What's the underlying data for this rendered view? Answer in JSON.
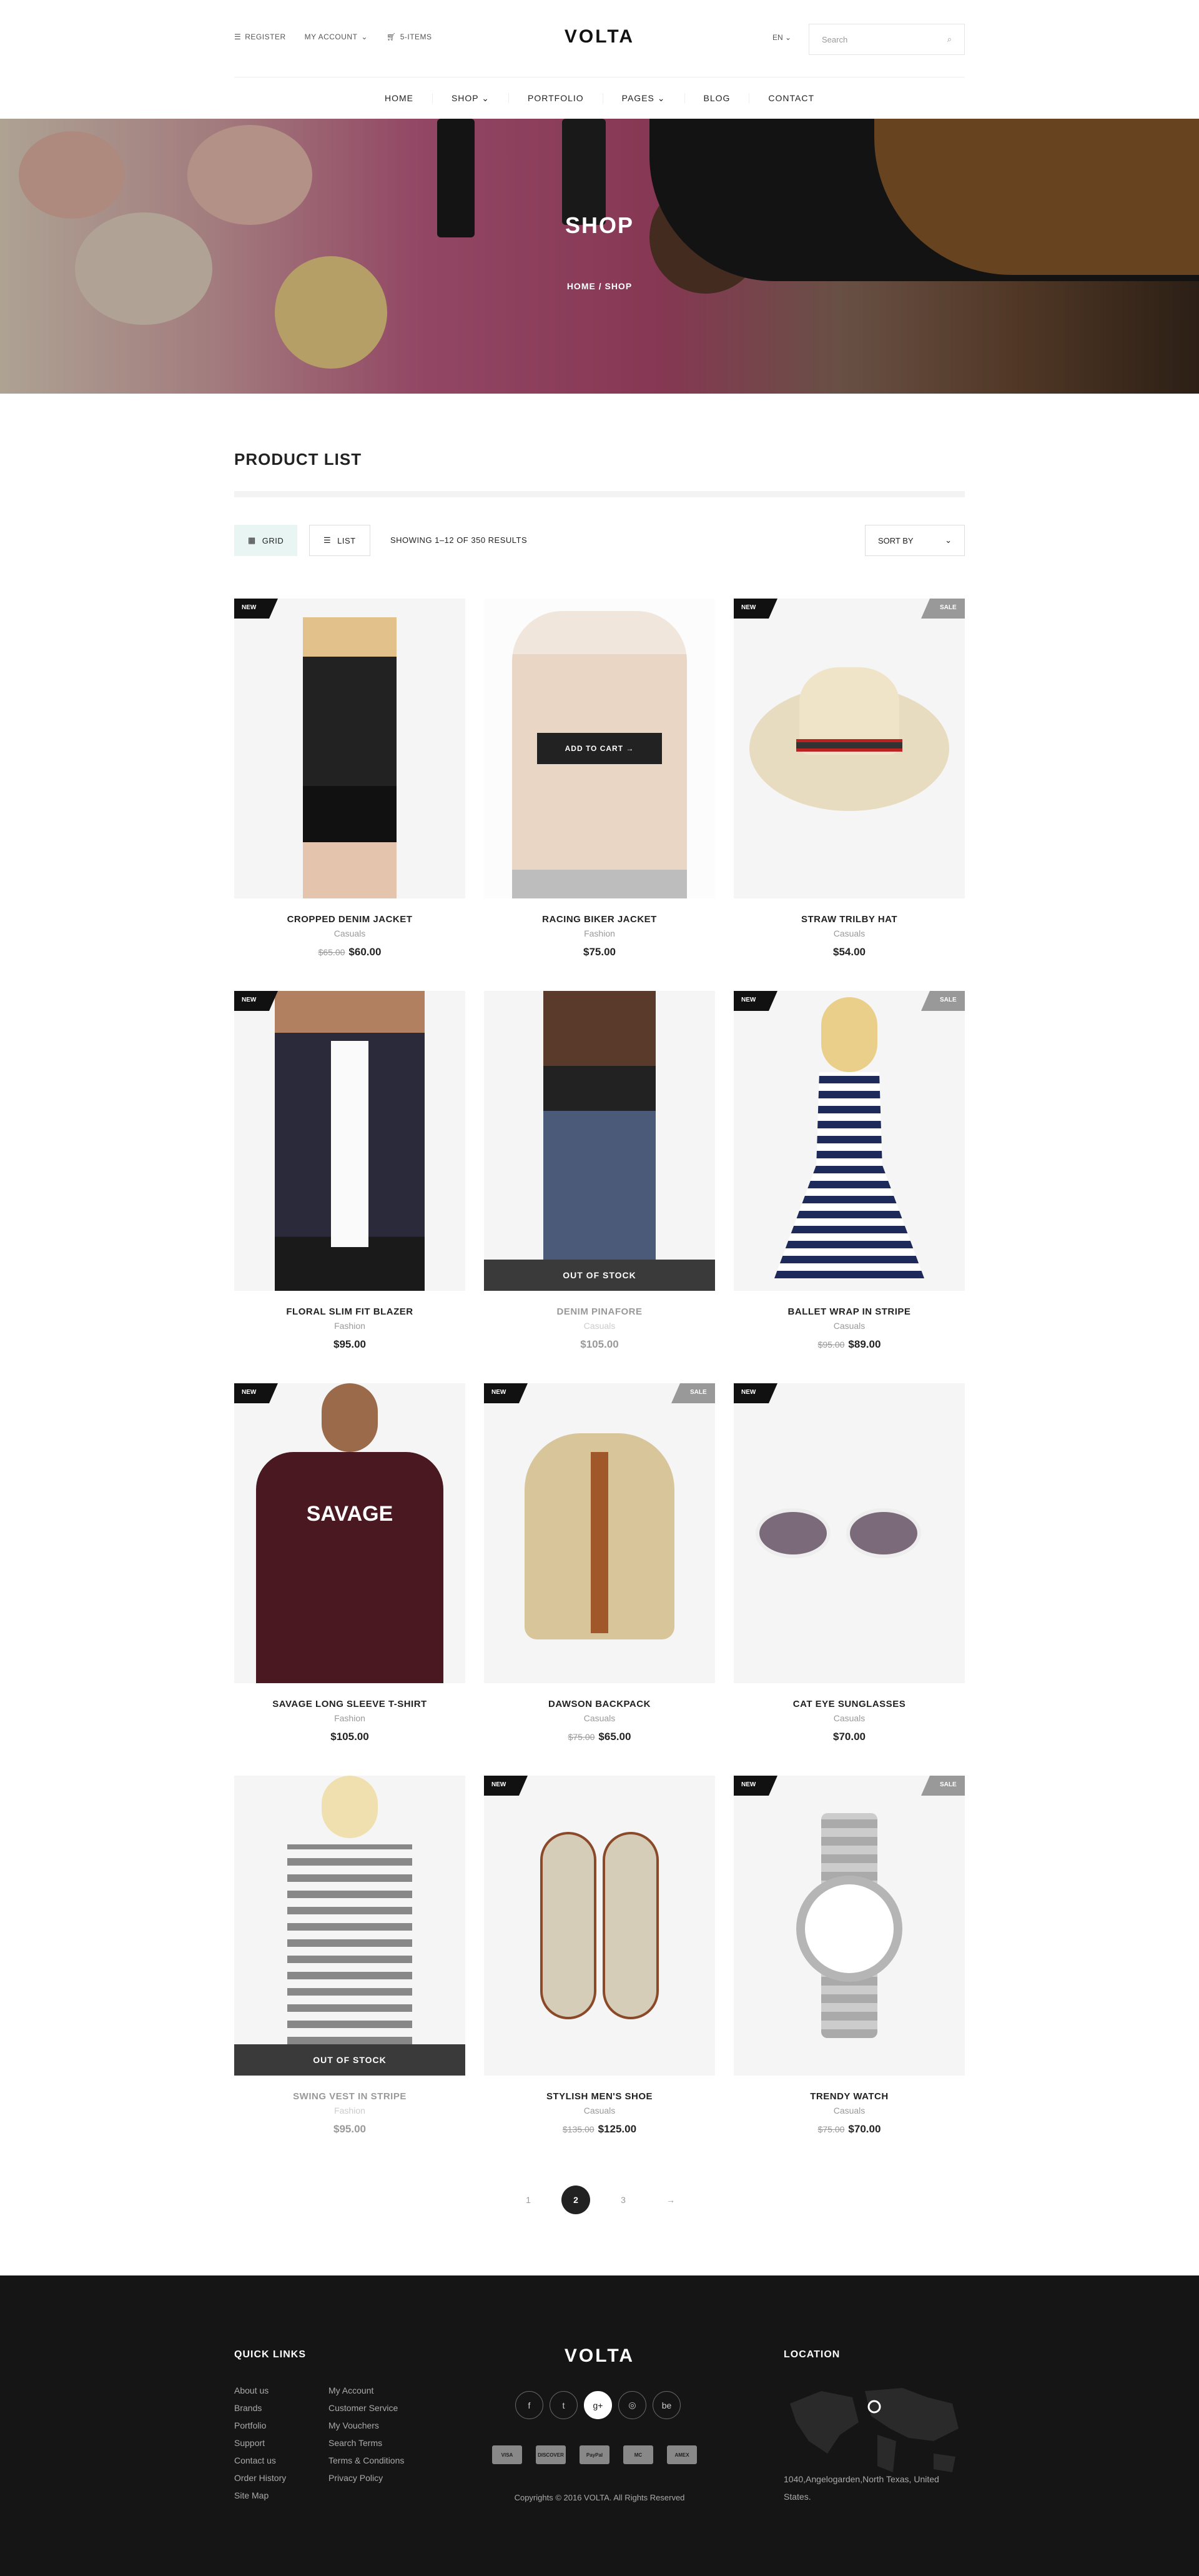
{
  "header": {
    "register": "REGISTER",
    "account": "MY ACCOUNT",
    "cart": "5-ITEMS",
    "logo": "VOLTA",
    "lang": "EN",
    "search_placeholder": "Search"
  },
  "nav": [
    "HOME",
    "SHOP",
    "PORTFOLIO",
    "PAGES",
    "BLOG",
    "CONTACT"
  ],
  "hero": {
    "title": "SHOP",
    "breadcrumb": "HOME  /  SHOP"
  },
  "list": {
    "title": "PRODUCT LIST",
    "grid": "GRID",
    "list": "LIST",
    "showing": "SHOWING 1–12 OF 350 RESULTS",
    "sort": "SORT BY"
  },
  "badges": {
    "new": "NEW",
    "sale": "SALE",
    "oos": "OUT OF STOCK",
    "atc": "ADD TO CART →"
  },
  "products": [
    {
      "name": "CROPPED DENIM JACKET",
      "cat": "Casuals",
      "old": "$65.00",
      "price": "$60.00"
    },
    {
      "name": "RACING BIKER JACKET",
      "cat": "Fashion",
      "old": "",
      "price": "$75.00"
    },
    {
      "name": "STRAW TRILBY HAT",
      "cat": "Casuals",
      "old": "",
      "price": "$54.00"
    },
    {
      "name": "FLORAL SLIM FIT BLAZER",
      "cat": "Fashion",
      "old": "",
      "price": "$95.00"
    },
    {
      "name": "DENIM PINAFORE",
      "cat": "Casuals",
      "old": "",
      "price": "$105.00"
    },
    {
      "name": "BALLET WRAP IN STRIPE",
      "cat": "Casuals",
      "old": "$95.00",
      "price": "$89.00"
    },
    {
      "name": "SAVAGE LONG SLEEVE T-SHIRT",
      "cat": "Fashion",
      "old": "",
      "price": "$105.00"
    },
    {
      "name": "DAWSON BACKPACK",
      "cat": "Casuals",
      "old": "$75.00",
      "price": "$65.00"
    },
    {
      "name": "CAT EYE SUNGLASSES",
      "cat": "Casuals",
      "old": "",
      "price": "$70.00"
    },
    {
      "name": "SWING VEST IN STRIPE",
      "cat": "Fashion",
      "old": "",
      "price": "$95.00"
    },
    {
      "name": "STYLISH MEN'S SHOE",
      "cat": "Casuals",
      "old": "$135.00",
      "price": "$125.00"
    },
    {
      "name": "TRENDY WATCH",
      "cat": "Casuals",
      "old": "$75.00",
      "price": "$70.00"
    }
  ],
  "pagination": [
    "1",
    "2",
    "3",
    "→"
  ],
  "footer": {
    "quick_title": "QUICK LINKS",
    "col1": [
      "About us",
      "Brands",
      "Portfolio",
      "Support",
      "Contact us",
      "Order History",
      "Site Map"
    ],
    "col2": [
      "My Account",
      "Customer Service",
      "My Vouchers",
      "Search Terms",
      "Terms & Conditions",
      "Privacy Policy"
    ],
    "logo": "VOLTA",
    "social": [
      "f",
      "t",
      "g+",
      "◎",
      "be"
    ],
    "payments": [
      "VISA",
      "DISCOVER",
      "PayPal",
      "MC",
      "AMEX"
    ],
    "copyright": "Copyrights © 2016 VOLTA. All Rights Reserved",
    "loc_title": "LOCATION",
    "address": "1040,Angelogarden,North Texas, United States."
  }
}
